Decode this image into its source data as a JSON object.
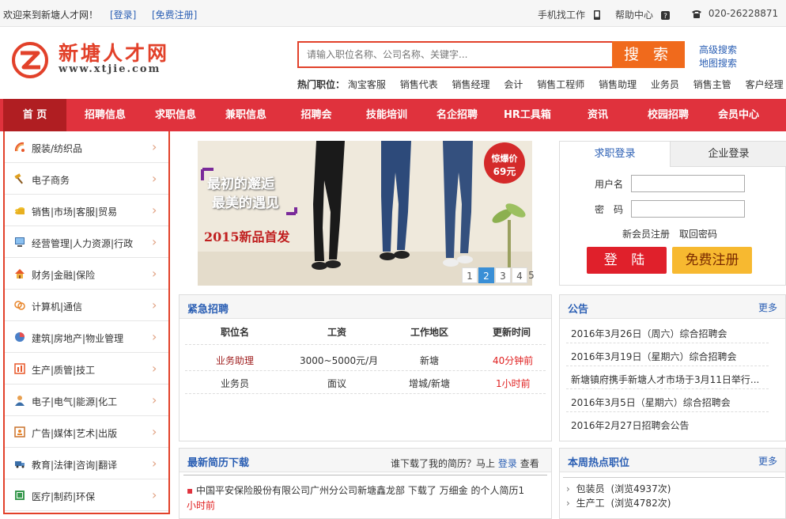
{
  "topbar": {
    "welcome": "欢迎来到新塘人才网！",
    "login": "[登录]",
    "register": "[免费注册]",
    "mobile": "手机找工作",
    "help": "帮助中心",
    "phone": "020-26228871"
  },
  "logo": {
    "cn": "新塘人才网",
    "en": "www.xtjie.com"
  },
  "search": {
    "placeholder": "请输入职位名称、公司名称、关键字...",
    "button": "搜 索",
    "advanced": "高级搜索",
    "map": "地图搜索"
  },
  "hot_jobs": {
    "label": "热门职位：",
    "items": [
      "淘宝客服",
      "销售代表",
      "销售经理",
      "会计",
      "销售工程师",
      "销售助理",
      "业务员",
      "销售主管",
      "客户经理"
    ]
  },
  "nav": [
    "首 页",
    "招聘信息",
    "求职信息",
    "兼职信息",
    "招聘会",
    "技能培训",
    "名企招聘",
    "HR工具箱",
    "资讯",
    "校园招聘",
    "会员中心"
  ],
  "categories": [
    {
      "label": "服装/纺织品",
      "icon": "fabric-icon"
    },
    {
      "label": "电子商务",
      "icon": "hammer-icon"
    },
    {
      "label": "销售|市场|客服|贸易",
      "icon": "coins-icon"
    },
    {
      "label": "经营管理|人力资源|行政",
      "icon": "monitor-icon"
    },
    {
      "label": "财务|金融|保险",
      "icon": "house-icon"
    },
    {
      "label": "计算机|通信",
      "icon": "chat-icon"
    },
    {
      "label": "建筑|房地产|物业管理",
      "icon": "pie-icon"
    },
    {
      "label": "生产|质管|技工",
      "icon": "factory-icon"
    },
    {
      "label": "电子|电气|能源|化工",
      "icon": "worker-icon"
    },
    {
      "label": "广告|媒体|艺术|出版",
      "icon": "frame-icon"
    },
    {
      "label": "教育|法律|咨询|翻译",
      "icon": "truck-icon"
    },
    {
      "label": "医疗|制药|环保",
      "icon": "medical-icon"
    }
  ],
  "banner": {
    "line1": "最初的邂逅",
    "line2": "最美的遇见",
    "promo": "2015新品首发",
    "badge1": "惊爆价",
    "badge2": "69元",
    "pages": [
      "1",
      "2",
      "3",
      "4",
      "5"
    ],
    "active_page": "2"
  },
  "login": {
    "tab_person": "求职登录",
    "tab_company": "企业登录",
    "user_label": "用户名",
    "pass_label": "密　码",
    "register_link": "新会员注册",
    "forgot_link": "取回密码",
    "login_button": "登 陆",
    "register_button": "免费注册"
  },
  "urgent": {
    "title": "紧急招聘",
    "headers": [
      "职位名",
      "工资",
      "工作地区",
      "更新时间"
    ],
    "rows": [
      {
        "title": "业务助理",
        "salary": "3000~5000元/月",
        "area": "新塘",
        "time": "40分钟前"
      },
      {
        "title": "业务员",
        "salary": "面议",
        "area": "增城/新塘",
        "time": "1小时前"
      }
    ]
  },
  "notice": {
    "title": "公告",
    "more": "更多",
    "items": [
      "2016年3月26日（周六）综合招聘会",
      "2016年3月19日（星期六）综合招聘会",
      "新塘镇府携手新塘人才市场于3月11日举行...",
      "2016年3月5日（星期六）综合招聘会",
      "2016年2月27日招聘会公告"
    ]
  },
  "resume": {
    "title": "最新简历下载",
    "prompt_prefix": "谁下载了我的简历？马上",
    "prompt_link": "登录",
    "prompt_suffix": "查看",
    "item_company": "中国平安保险股份有限公司广州分公司新塘鑫龙部",
    "item_mid": "下载了",
    "item_name": "万细金",
    "item_suffix": "的个人简历1",
    "item_time": "小时前"
  },
  "hotweek": {
    "title": "本周热点职位",
    "more": "更多",
    "items": [
      {
        "name": "包装员",
        "views": "(浏览4937次)"
      },
      {
        "name": "生产工",
        "views": "(浏览4782次)"
      }
    ]
  },
  "colors": {
    "brand_red": "#e0323d",
    "nav_active": "#b01e22",
    "link_blue": "#2b5fb4",
    "orange": "#f06a1c"
  }
}
